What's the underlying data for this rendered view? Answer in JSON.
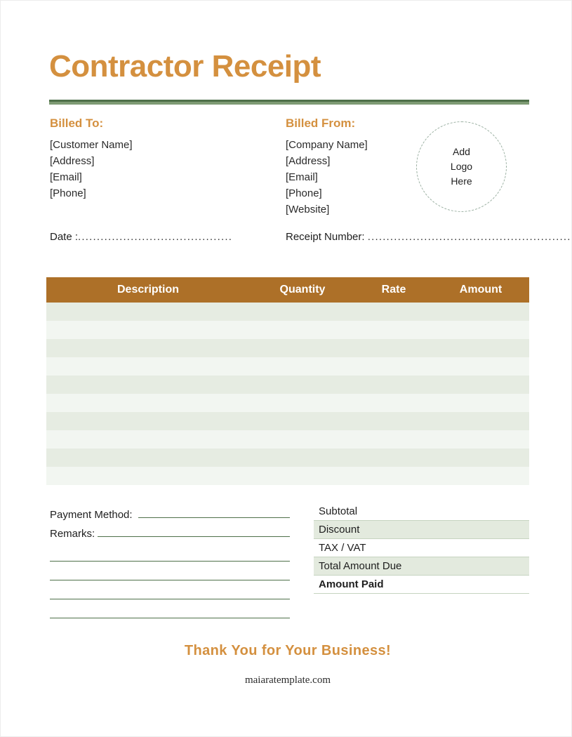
{
  "document": {
    "title": "Contractor Receipt"
  },
  "billed_to": {
    "heading": "Billed To:",
    "lines": [
      "[Customer Name]",
      "[Address]",
      "[Email]",
      "[Phone]"
    ]
  },
  "billed_from": {
    "heading": "Billed From:",
    "lines": [
      "[Company Name]",
      "[Address]",
      "[Email]",
      "[Phone]",
      "[Website]"
    ]
  },
  "logo_placeholder": {
    "line1": "Add",
    "line2": "Logo",
    "line3": "Here"
  },
  "meta": {
    "date_label": "Date :",
    "date_value": "",
    "date_dots": ".........................................",
    "receipt_label": "Receipt Number:",
    "receipt_value": "",
    "receipt_dots": "......................................................."
  },
  "items_table": {
    "columns": [
      "Description",
      "Quantity",
      "Rate",
      "Amount"
    ],
    "rows": [
      {
        "description": "",
        "quantity": "",
        "rate": "",
        "amount": ""
      },
      {
        "description": "",
        "quantity": "",
        "rate": "",
        "amount": ""
      },
      {
        "description": "",
        "quantity": "",
        "rate": "",
        "amount": ""
      },
      {
        "description": "",
        "quantity": "",
        "rate": "",
        "amount": ""
      },
      {
        "description": "",
        "quantity": "",
        "rate": "",
        "amount": ""
      },
      {
        "description": "",
        "quantity": "",
        "rate": "",
        "amount": ""
      },
      {
        "description": "",
        "quantity": "",
        "rate": "",
        "amount": ""
      },
      {
        "description": "",
        "quantity": "",
        "rate": "",
        "amount": ""
      },
      {
        "description": "",
        "quantity": "",
        "rate": "",
        "amount": ""
      },
      {
        "description": "",
        "quantity": "",
        "rate": "",
        "amount": ""
      }
    ]
  },
  "payment": {
    "method_label": "Payment Method:",
    "method_value": "",
    "remarks_label": "Remarks:",
    "remarks_value": "",
    "extra_blank_lines": 4
  },
  "totals": [
    {
      "label": "Subtotal",
      "value": "",
      "shaded": false,
      "bold": false
    },
    {
      "label": "Discount",
      "value": "",
      "shaded": true,
      "bold": false
    },
    {
      "label": "TAX / VAT",
      "value": "",
      "shaded": false,
      "bold": false
    },
    {
      "label": "Total Amount Due",
      "value": "",
      "shaded": true,
      "bold": false
    },
    {
      "label": "Amount Paid",
      "value": "",
      "shaded": false,
      "bold": true
    }
  ],
  "footer": {
    "thanks": "Thank You for Your Business!",
    "website": "maiaratemplate.com"
  },
  "colors": {
    "accent_orange": "#d4903f",
    "table_header_brown": "#ad7028",
    "divider_dark_green": "#4e7049",
    "divider_light_green": "#7e9b74",
    "row_band_dark": "#e6ece2",
    "row_band_light": "#f2f6f1",
    "totals_shade": "#e3eade"
  }
}
